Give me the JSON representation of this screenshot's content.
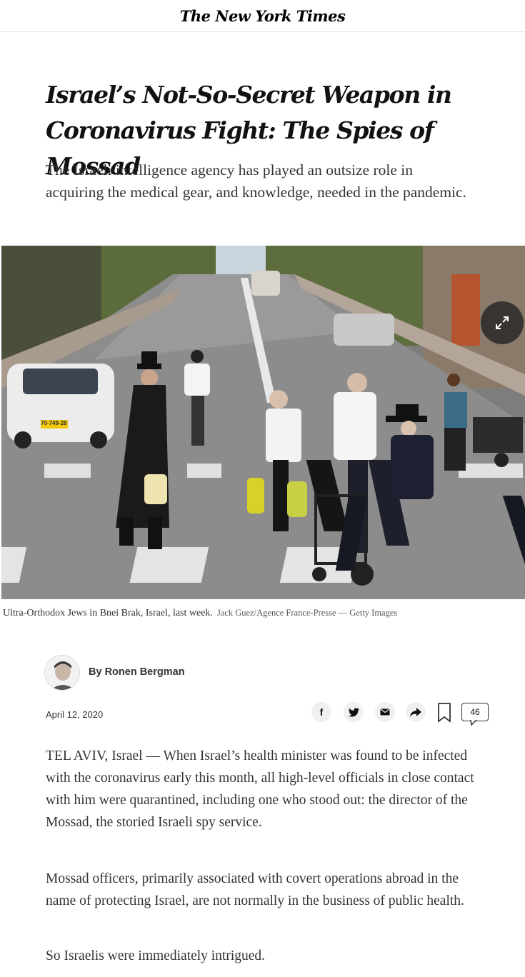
{
  "masthead": {
    "logo": "The New York Times"
  },
  "article": {
    "headline": "Israel’s Not-So-Secret Weapon in Coronavirus Fight: The Spies of Mossad",
    "summary": "The Israeli intelligence agency has played an outsize role in acquiring the medical gear, and knowledge, needed in the pandemic.",
    "image": {
      "caption": "Ultra-Orthodox Jews in Bnei Brak, Israel, last week.",
      "credit": "Jack Guez/Agence France-Presse — Getty Images",
      "license_plate": "70-749-28"
    },
    "byline": "By Ronen Bergman",
    "date": "April 12, 2020",
    "comment_count": "46",
    "paragraphs": [
      "TEL AVIV, Israel — When Israel’s health minister was found to be infected with the coronavirus early this month, all high-level officials in close contact with him were quarantined, including one who stood out: the director of the Mossad, the storied Israeli spy service.",
      "Mossad officers, primarily associated with covert operations abroad in the name of protecting Israel, are not normally in the business of public health.",
      "So Israelis were immediately intrigued."
    ]
  },
  "share": {
    "facebook_glyph": "f",
    "icons": [
      "facebook-icon",
      "twitter-icon",
      "email-icon",
      "share-arrow-icon",
      "bookmark-icon",
      "comment-icon"
    ]
  }
}
